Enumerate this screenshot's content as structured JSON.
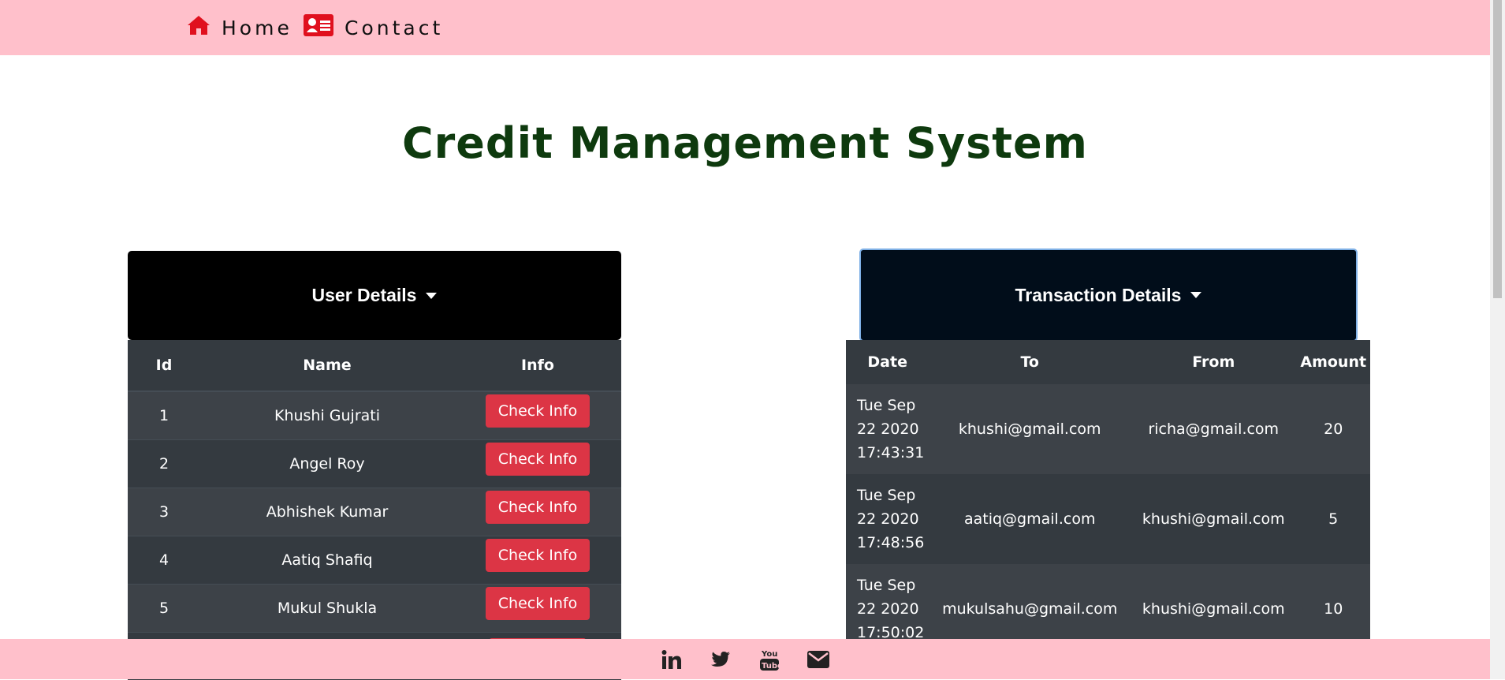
{
  "nav": {
    "home_label": "Home",
    "contact_label": "Contact",
    "home_icon": "home-icon",
    "contact_icon": "contact-card-icon"
  },
  "page_title": "Credit Management System",
  "user_panel": {
    "toggle_label": "User Details",
    "columns": [
      "Id",
      "Name",
      "Info"
    ],
    "rows": [
      {
        "id": "1",
        "name": "Khushi Gujrati",
        "action": "Check Info"
      },
      {
        "id": "2",
        "name": "Angel Roy",
        "action": "Check Info"
      },
      {
        "id": "3",
        "name": "Abhishek Kumar",
        "action": "Check Info"
      },
      {
        "id": "4",
        "name": "Aatiq Shafiq",
        "action": "Check Info"
      },
      {
        "id": "5",
        "name": "Mukul Shukla",
        "action": "Check Info"
      },
      {
        "id": "",
        "name": "",
        "action": ""
      }
    ]
  },
  "transaction_panel": {
    "toggle_label": "Transaction Details",
    "columns": [
      "Date",
      "To",
      "From",
      "Amount"
    ],
    "rows": [
      {
        "date": "Tue Sep 22 2020 17:43:31",
        "to": "khushi@gmail.com",
        "from": "richa@gmail.com",
        "amount": "20"
      },
      {
        "date": "Tue Sep 22 2020 17:48:56",
        "to": "aatiq@gmail.com",
        "from": "khushi@gmail.com",
        "amount": "5"
      },
      {
        "date": "Tue Sep 22 2020 17:50:02",
        "to": "mukulsahu@gmail.com",
        "from": "khushi@gmail.com",
        "amount": "10"
      }
    ]
  },
  "footer": {
    "icons": [
      "linkedin-icon",
      "twitter-icon",
      "youtube-icon",
      "mail-icon"
    ]
  },
  "colors": {
    "nav_bg": "#ffc0cb",
    "title": "#0e3a0e",
    "table_bg": "#343a40",
    "button": "#dc3545",
    "nav_icon": "#e0101e"
  }
}
